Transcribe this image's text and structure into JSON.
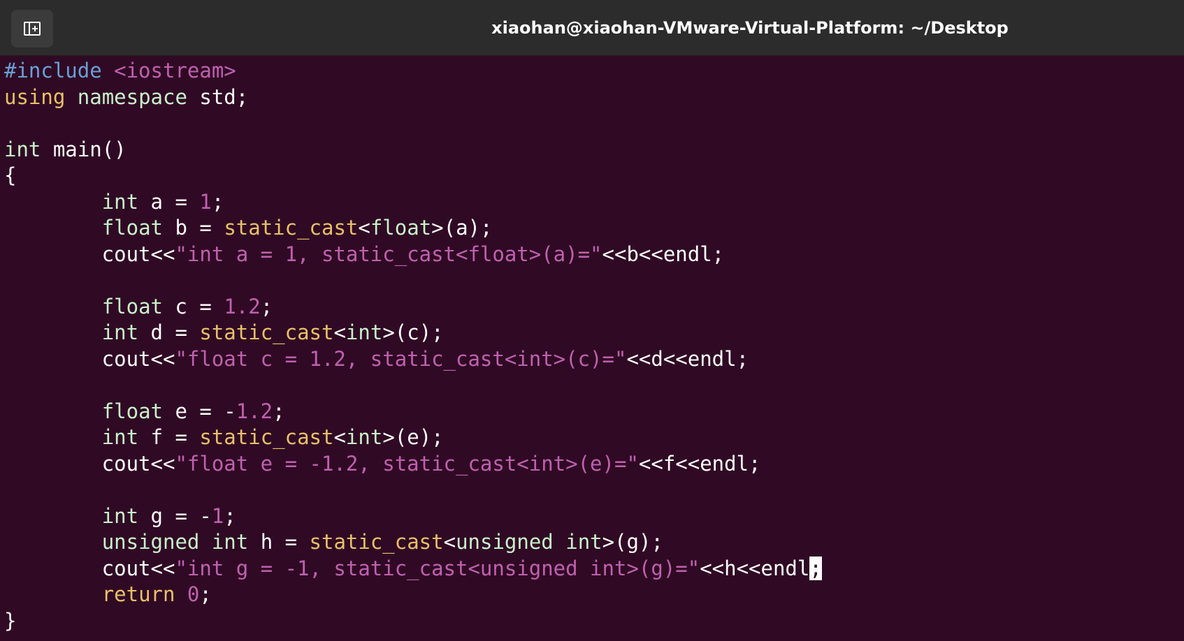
{
  "window": {
    "title": "xiaohan@xiaohan-VMware-Virtual-Platform: ~/Desktop",
    "new_tab_icon": "new-tab-icon"
  },
  "colors": {
    "background": "#300a24",
    "titlebar": "#2c2c2c",
    "preprocessor": "#6a9fd8",
    "type": "#c9f0cc",
    "keyword": "#e8c06a",
    "string": "#c060b0",
    "default_text": "#ffffff"
  },
  "editor": {
    "cursor": ";",
    "lines": [
      [
        [
          "pre",
          "#include "
        ],
        [
          "str",
          "<iostream>"
        ]
      ],
      [
        [
          "kw",
          "using"
        ],
        [
          "plain",
          " "
        ],
        [
          "type",
          "namespace"
        ],
        [
          "plain",
          " std;"
        ]
      ],
      [],
      [
        [
          "type",
          "int"
        ],
        [
          "plain",
          " main()"
        ]
      ],
      [
        [
          "plain",
          "{"
        ]
      ],
      [
        [
          "plain",
          "        "
        ],
        [
          "type",
          "int"
        ],
        [
          "plain",
          " a = "
        ],
        [
          "num",
          "1"
        ],
        [
          "plain",
          ";"
        ]
      ],
      [
        [
          "plain",
          "        "
        ],
        [
          "type",
          "float"
        ],
        [
          "plain",
          " b = "
        ],
        [
          "fn",
          "static_cast"
        ],
        [
          "plain",
          "<"
        ],
        [
          "type",
          "float"
        ],
        [
          "plain",
          ">(a);"
        ]
      ],
      [
        [
          "plain",
          "        cout<<"
        ],
        [
          "str",
          "\"int a = 1, static_cast<float>(a)=\""
        ],
        [
          "plain",
          "<<b<<endl;"
        ]
      ],
      [],
      [
        [
          "plain",
          "        "
        ],
        [
          "type",
          "float"
        ],
        [
          "plain",
          " c = "
        ],
        [
          "num",
          "1.2"
        ],
        [
          "plain",
          ";"
        ]
      ],
      [
        [
          "plain",
          "        "
        ],
        [
          "type",
          "int"
        ],
        [
          "plain",
          " d = "
        ],
        [
          "fn",
          "static_cast"
        ],
        [
          "plain",
          "<"
        ],
        [
          "type",
          "int"
        ],
        [
          "plain",
          ">(c);"
        ]
      ],
      [
        [
          "plain",
          "        cout<<"
        ],
        [
          "str",
          "\"float c = 1.2, static_cast<int>(c)=\""
        ],
        [
          "plain",
          "<<d<<endl;"
        ]
      ],
      [],
      [
        [
          "plain",
          "        "
        ],
        [
          "type",
          "float"
        ],
        [
          "plain",
          " e = -"
        ],
        [
          "num",
          "1.2"
        ],
        [
          "plain",
          ";"
        ]
      ],
      [
        [
          "plain",
          "        "
        ],
        [
          "type",
          "int"
        ],
        [
          "plain",
          " f = "
        ],
        [
          "fn",
          "static_cast"
        ],
        [
          "plain",
          "<"
        ],
        [
          "type",
          "int"
        ],
        [
          "plain",
          ">(e);"
        ]
      ],
      [
        [
          "plain",
          "        cout<<"
        ],
        [
          "str",
          "\"float e = -1.2, static_cast<int>(e)=\""
        ],
        [
          "plain",
          "<<f<<endl;"
        ]
      ],
      [],
      [
        [
          "plain",
          "        "
        ],
        [
          "type",
          "int"
        ],
        [
          "plain",
          " g = -"
        ],
        [
          "num",
          "1"
        ],
        [
          "plain",
          ";"
        ]
      ],
      [
        [
          "plain",
          "        "
        ],
        [
          "type",
          "unsigned"
        ],
        [
          "plain",
          " "
        ],
        [
          "type",
          "int"
        ],
        [
          "plain",
          " h = "
        ],
        [
          "fn",
          "static_cast"
        ],
        [
          "plain",
          "<"
        ],
        [
          "type",
          "unsigned"
        ],
        [
          "plain",
          " "
        ],
        [
          "type",
          "int"
        ],
        [
          "plain",
          ">(g);"
        ]
      ],
      [
        [
          "plain",
          "        cout<<"
        ],
        [
          "str",
          "\"int g = -1, static_cast<unsigned int>(g)=\""
        ],
        [
          "plain",
          "<<h<<endl"
        ],
        [
          "cursor",
          ";"
        ]
      ],
      [
        [
          "plain",
          "        "
        ],
        [
          "kw",
          "return"
        ],
        [
          "plain",
          " "
        ],
        [
          "num",
          "0"
        ],
        [
          "plain",
          ";"
        ]
      ],
      [
        [
          "plain",
          "}"
        ]
      ]
    ]
  }
}
